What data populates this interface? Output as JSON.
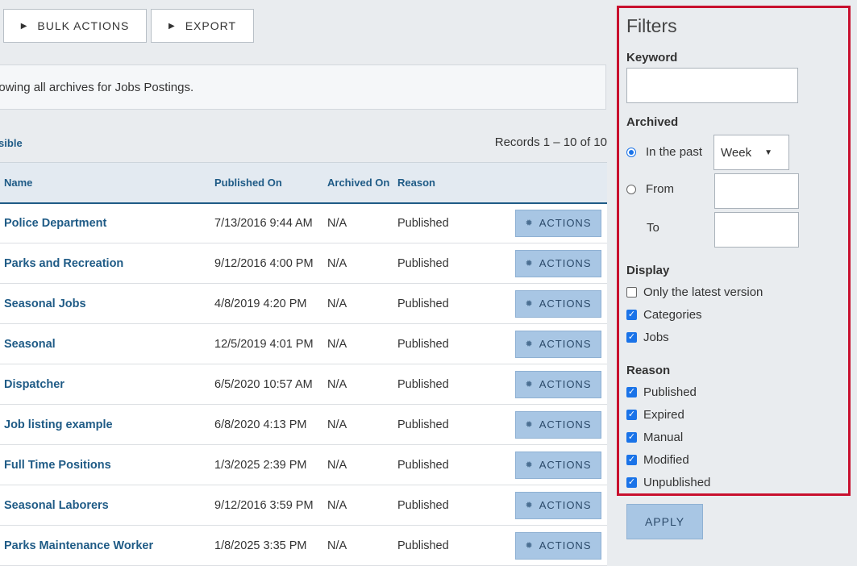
{
  "toolbar": {
    "bulk_actions_label": "BULK ACTIONS",
    "export_label": "EXPORT"
  },
  "info": {
    "message": "Showing all archives for Jobs Postings."
  },
  "visible_link": "Visible",
  "records": "Records 1 – 10 of 10",
  "table": {
    "headers": {
      "name": "Name",
      "published": "Published On",
      "archived": "Archived On",
      "reason": "Reason"
    },
    "action_label": "ACTIONS",
    "rows": [
      {
        "name": "Police Department",
        "published": "7/13/2016 9:44 AM",
        "archived": "N/A",
        "reason": "Published"
      },
      {
        "name": "Parks and Recreation",
        "published": "9/12/2016 4:00 PM",
        "archived": "N/A",
        "reason": "Published"
      },
      {
        "name": "Seasonal Jobs",
        "published": "4/8/2019 4:20 PM",
        "archived": "N/A",
        "reason": "Published"
      },
      {
        "name": "Seasonal",
        "published": "12/5/2019 4:01 PM",
        "archived": "N/A",
        "reason": "Published"
      },
      {
        "name": "Dispatcher",
        "published": "6/5/2020 10:57 AM",
        "archived": "N/A",
        "reason": "Published"
      },
      {
        "name": "Job listing example",
        "published": "6/8/2020 4:13 PM",
        "archived": "N/A",
        "reason": "Published"
      },
      {
        "name": "Full Time Positions",
        "published": "1/3/2025 2:39 PM",
        "archived": "N/A",
        "reason": "Published"
      },
      {
        "name": "Seasonal Laborers",
        "published": "9/12/2016 3:59 PM",
        "archived": "N/A",
        "reason": "Published"
      },
      {
        "name": "Parks Maintenance Worker",
        "published": "1/8/2025 3:35 PM",
        "archived": "N/A",
        "reason": "Published"
      }
    ]
  },
  "filters": {
    "title": "Filters",
    "keyword_label": "Keyword",
    "keyword_value": "",
    "archived_label": "Archived",
    "in_the_past_label": "In the past",
    "in_the_past_selected": true,
    "period_value": "Week",
    "from_label": "From",
    "to_label": "To",
    "display_label": "Display",
    "display_options": [
      {
        "label": "Only the latest version",
        "checked": false
      },
      {
        "label": "Categories",
        "checked": true
      },
      {
        "label": "Jobs",
        "checked": true
      }
    ],
    "reason_label": "Reason",
    "reason_options": [
      {
        "label": "Published",
        "checked": true
      },
      {
        "label": "Expired",
        "checked": true
      },
      {
        "label": "Manual",
        "checked": true
      },
      {
        "label": "Modified",
        "checked": true
      },
      {
        "label": "Unpublished",
        "checked": true
      }
    ],
    "apply_label": "APPLY"
  },
  "colors": {
    "accent": "#1f5b86",
    "highlight_border": "#c8102e",
    "button_blue": "#a8c6e4"
  }
}
